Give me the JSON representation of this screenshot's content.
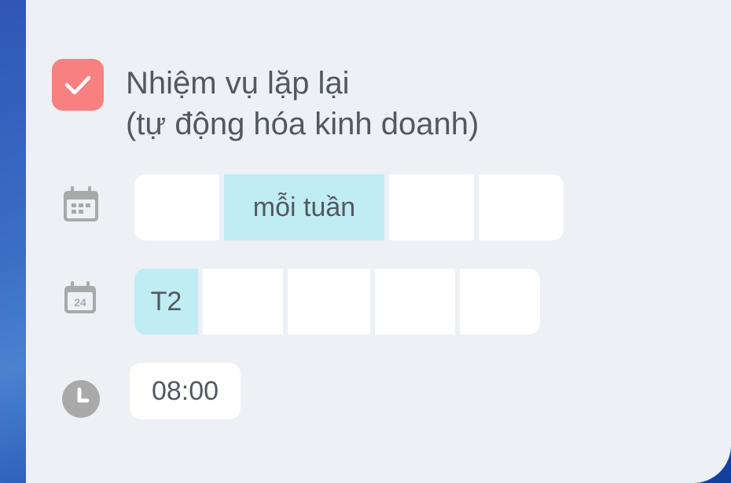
{
  "task": {
    "title_line1": "Nhiệm vụ lặp lại",
    "title_line2": "(tự động hóa kinh doanh)",
    "checked": true
  },
  "frequency": {
    "icon": "calendar-grid-icon",
    "options": [
      "",
      "mỗi tuần",
      "",
      ""
    ],
    "selected_index": 1
  },
  "weekday": {
    "icon": "calendar-date-icon",
    "icon_text": "24",
    "options": [
      "T2",
      "",
      "",
      "",
      ""
    ],
    "selected_index": 0
  },
  "time": {
    "icon": "clock-icon",
    "value": "08:00"
  },
  "colors": {
    "checkbox": "#f78080",
    "selected_segment": "#c0ecf3",
    "card_background": "#edf0f5",
    "text": "#515860",
    "icon": "#a9a9a9"
  }
}
